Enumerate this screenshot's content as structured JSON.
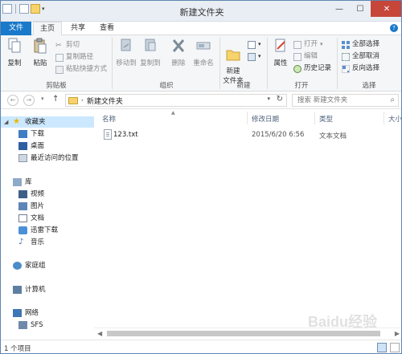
{
  "window": {
    "title": "新建文件夹"
  },
  "tabs": [
    {
      "label": "文件"
    },
    {
      "label": "主页"
    },
    {
      "label": "共享"
    },
    {
      "label": "查看"
    }
  ],
  "ribbon": {
    "clipboard": {
      "label": "剪贴板",
      "copy": "复制",
      "paste": "粘贴",
      "cut": "剪切",
      "copy_path": "复制路径",
      "paste_shortcut": "粘贴快捷方式"
    },
    "organize": {
      "label": "组织",
      "move_to": "移动到",
      "copy_to": "复制到",
      "delete": "删除",
      "rename": "重命名"
    },
    "new": {
      "label": "新建",
      "new_folder": "新建\n文件夹"
    },
    "open": {
      "label": "打开",
      "properties": "属性",
      "open": "打开",
      "edit": "编辑",
      "history": "历史记录"
    },
    "select": {
      "label": "选择",
      "select_all": "全部选择",
      "select_none": "全部取消",
      "invert": "反向选择"
    }
  },
  "address": {
    "path": "新建文件夹",
    "search_placeholder": "搜索 新建文件夹"
  },
  "navpane": {
    "favorites": "收藏夹",
    "downloads": "下载",
    "desktop": "桌面",
    "recent": "最近访问的位置",
    "libraries": "库",
    "videos": "视频",
    "pictures": "图片",
    "documents": "文档",
    "thunder": "迅雷下载",
    "music": "音乐",
    "homegroup": "家庭组",
    "computer": "计算机",
    "network": "网络",
    "sfs": "SFS"
  },
  "columns": {
    "name": "名称",
    "date": "修改日期",
    "type": "类型",
    "size": "大小"
  },
  "files": [
    {
      "name": "123.txt",
      "date": "2015/6/20 6:56",
      "type": "文本文档"
    }
  ],
  "status": {
    "count": "1 个项目"
  },
  "watermark": "Baidu经验",
  "colors": {
    "accent": "#1979ca",
    "selection": "#cce8ff",
    "folder": "#f6d36b",
    "close": "#c7463a"
  }
}
